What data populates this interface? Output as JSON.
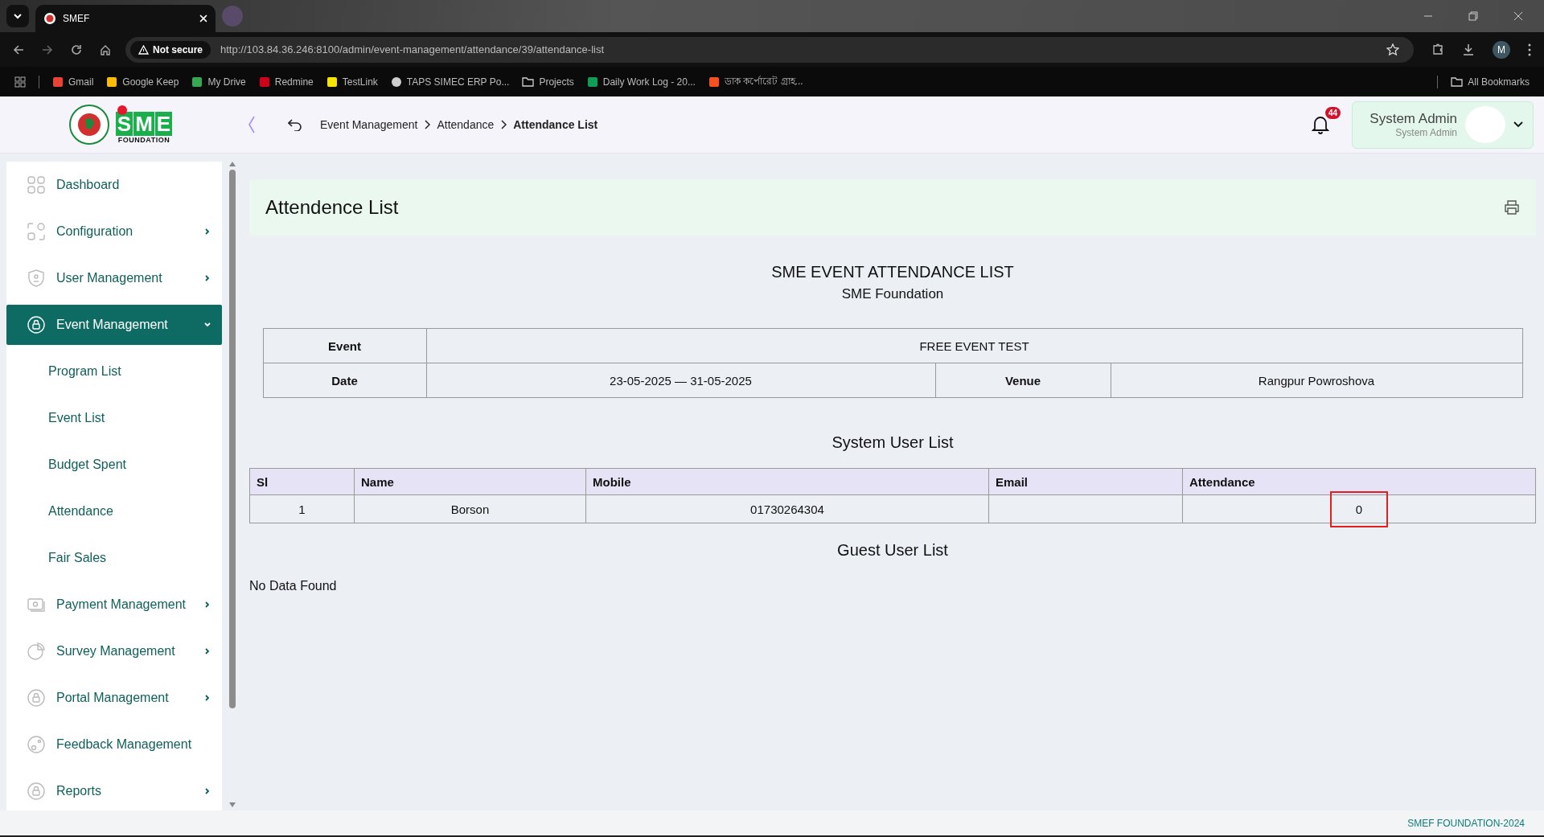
{
  "browser": {
    "tab_title": "SMEF",
    "security": "Not secure",
    "url": "http://103.84.36.246:8100/admin/event-management/attendance/39/attendance-list",
    "profile_initial": "M",
    "bookmarks": [
      {
        "kind": "gmail",
        "label": "Gmail"
      },
      {
        "kind": "keep",
        "label": "Google Keep"
      },
      {
        "kind": "drive",
        "label": "My Drive"
      },
      {
        "kind": "redmine",
        "label": "Redmine"
      },
      {
        "kind": "testlink",
        "label": "TestLink"
      },
      {
        "kind": "globe",
        "label": "TAPS SIMEC ERP Po..."
      },
      {
        "kind": "folder",
        "label": "Projects"
      },
      {
        "kind": "sheets",
        "label": "Daily Work Log - 20..."
      },
      {
        "kind": "app",
        "label": "ডাক কর্পোরেট গ্রাহ..."
      }
    ],
    "all_bookmarks": "All Bookmarks"
  },
  "logo": {
    "letters": [
      "S",
      "M",
      "E"
    ],
    "caption": "FOUNDATION"
  },
  "breadcrumb": [
    {
      "label": "Event Management",
      "current": false
    },
    {
      "label": "Attendance",
      "current": false
    },
    {
      "label": "Attendance List",
      "current": true
    }
  ],
  "notifications": {
    "count": "44"
  },
  "user": {
    "name": "System Admin",
    "role": "System Admin"
  },
  "sidebar": {
    "items": [
      {
        "label": "Dashboard",
        "kind": "link",
        "selected": false
      },
      {
        "label": "Configuration",
        "kind": "group",
        "selected": false,
        "expanded": false
      },
      {
        "label": "User Management",
        "kind": "group",
        "selected": false,
        "expanded": false
      },
      {
        "label": "Event Management",
        "kind": "group",
        "selected": true,
        "expanded": true,
        "children": [
          {
            "label": "Program List",
            "selected": false
          },
          {
            "label": "Event List",
            "selected": false
          },
          {
            "label": "Budget Spent",
            "selected": false
          },
          {
            "label": "Attendance",
            "selected": false
          },
          {
            "label": "Fair Sales",
            "selected": false
          }
        ]
      },
      {
        "label": "Payment Management",
        "kind": "group",
        "selected": false,
        "expanded": false
      },
      {
        "label": "Survey Management",
        "kind": "group",
        "selected": false,
        "expanded": false
      },
      {
        "label": "Portal Management",
        "kind": "group",
        "selected": false,
        "expanded": false
      },
      {
        "label": "Feedback Management",
        "kind": "link",
        "selected": false
      },
      {
        "label": "Reports",
        "kind": "group",
        "selected": false,
        "expanded": false
      }
    ]
  },
  "page": {
    "title": "Attendence List",
    "report_title": "SME EVENT ATTENDANCE LIST",
    "report_subtitle": "SME Foundation",
    "event_info": {
      "event_label": "Event",
      "event": "FREE EVENT TEST",
      "date_label": "Date",
      "date": "23-05-2025 — 31-05-2025",
      "venue_label": "Venue",
      "venue": "Rangpur Powroshova"
    },
    "system_users": {
      "title": "System User List",
      "columns": [
        "Sl",
        "Name",
        "Mobile",
        "Email",
        "Attendance"
      ],
      "rows": [
        {
          "sl": "1",
          "name": "Borson",
          "mobile": "01730264304",
          "email": "",
          "attendance": "0",
          "highlighted": true
        }
      ]
    },
    "guest_users": {
      "title": "Guest User List",
      "empty": "No Data Found"
    }
  },
  "footer": "SMEF FOUNDATION-2024"
}
